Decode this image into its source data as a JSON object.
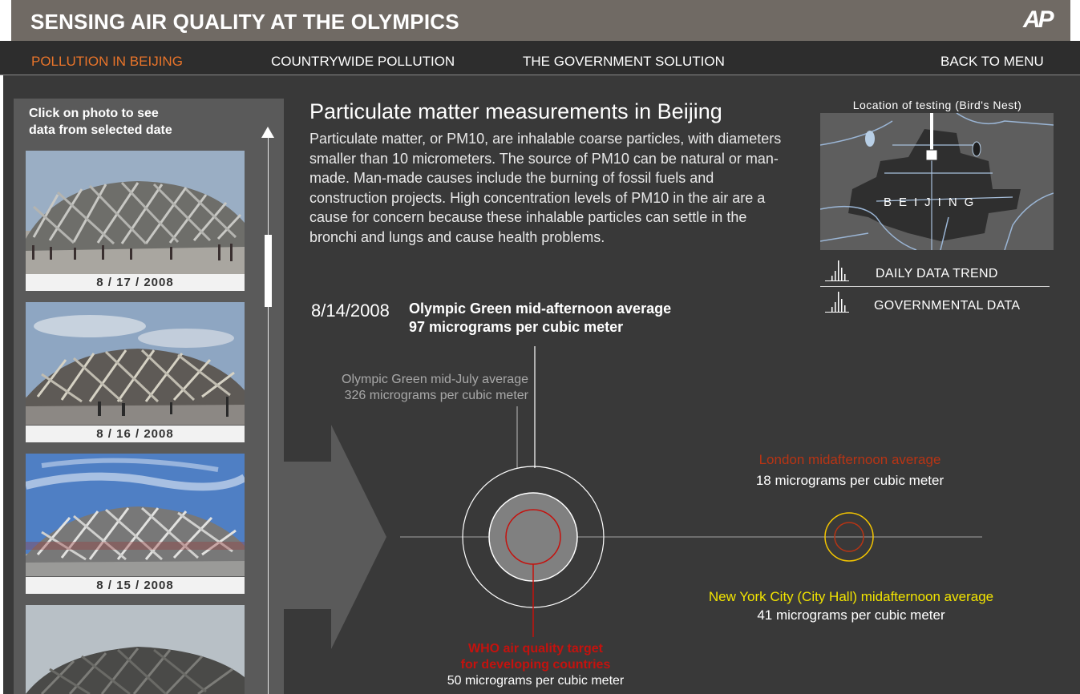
{
  "header": {
    "title": "SENSING AIR QUALITY AT THE OLYMPICS",
    "logo_text": "AP"
  },
  "nav": {
    "items": [
      {
        "label": "POLLUTION IN BEIJING",
        "active": true
      },
      {
        "label": "COUNTRYWIDE POLLUTION",
        "active": false
      },
      {
        "label": "THE GOVERNMENT SOLUTION",
        "active": false
      },
      {
        "label": "BACK TO MENU",
        "active": false
      }
    ],
    "active_color": "#e8742a"
  },
  "photo_panel": {
    "instruction_line1": "Click on photo to see",
    "instruction_line2": "data from selected date",
    "photos": [
      {
        "date": "8 / 17 / 2008"
      },
      {
        "date": "8 / 16 / 2008"
      },
      {
        "date": "8 / 15 / 2008"
      },
      {
        "date": ""
      }
    ]
  },
  "content": {
    "title": "Particulate matter measurements in Beijing",
    "description": "Particulate matter, or PM10, are inhalable coarse particles, with diameters smaller than 10 micrometers. The source of PM10 can be natural or man-made. Man-made causes include the burning of fossil fuels and construction projects. High concentration levels of PM10 in the air are a cause for concern because these inhalable particles can settle in the bronchi and lungs and cause health problems."
  },
  "map": {
    "label": "Location of testing (Bird's Nest)",
    "city": "BEIJING"
  },
  "legend": {
    "daily": "DAILY DATA TREND",
    "government": "GOVERNMENTAL DATA"
  },
  "measurement": {
    "date": "8/14/2008",
    "line1": "Olympic Green mid-afternoon average",
    "line2": "97 micrograms per cubic meter",
    "value": 97
  },
  "comparisons": {
    "july": {
      "line1": "Olympic Green mid-July average",
      "line2": "326 micrograms per cubic meter",
      "value": 326
    },
    "london": {
      "line1": "London midafternoon average",
      "line2": "18 micrograms per cubic meter",
      "value": 18
    },
    "nyc": {
      "line1": "New York City (City Hall) midafternoon average",
      "line2": "41 micrograms per cubic meter",
      "value": 41
    },
    "who": {
      "line1": "WHO air quality target",
      "line2": "for developing countries",
      "line3": "50 micrograms per cubic meter",
      "value": 50
    }
  },
  "colors": {
    "header_bg": "#706a64",
    "main_bg": "#393939",
    "who_red": "#c4120e",
    "london_orange": "#b83414",
    "nyc_yellow": "#f2e400"
  }
}
